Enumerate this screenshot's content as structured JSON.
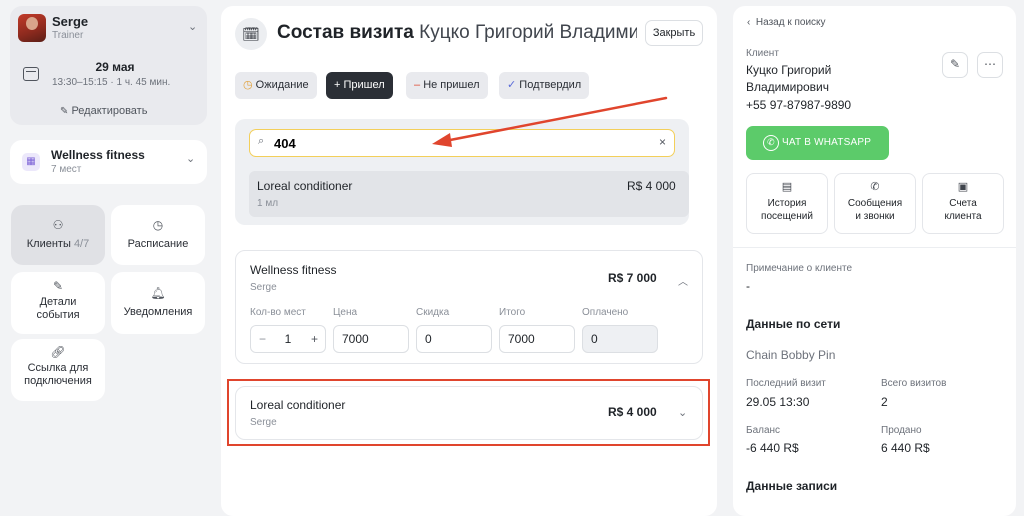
{
  "user": {
    "name": "Serge",
    "role": "Trainer"
  },
  "appointment": {
    "date": "29 мая",
    "time": "13:30–15:15 · 1 ч. 45 мин.",
    "edit_label": "Редактировать"
  },
  "venue": {
    "name": "Wellness fitness",
    "capacity": "7 мест"
  },
  "left_nav": [
    {
      "label": "Клиенты",
      "count": "4/7",
      "icon": "people-icon"
    },
    {
      "label": "Расписание",
      "icon": "clock-icon"
    },
    {
      "label": "Детали события",
      "icon": "edit-doc-icon"
    },
    {
      "label": "Уведомления",
      "icon": "bell-icon"
    },
    {
      "label": "Ссылка для подключения",
      "icon": "link-icon"
    }
  ],
  "header": {
    "title": "Состав визита",
    "client_name": "Куцко Григорий Владими...",
    "close_label": "Закрыть"
  },
  "status_chips": [
    {
      "label": "Ожидание",
      "icon": "clock-icon"
    },
    {
      "label": "Пришел",
      "icon": "plus-icon"
    },
    {
      "label": "Не пришел",
      "icon": "minus-icon"
    },
    {
      "label": "Подтвердил",
      "icon": "check-icon"
    }
  ],
  "search": {
    "value": "404",
    "placeholder": ""
  },
  "search_result": {
    "name": "Loreal conditioner",
    "unit": "1 мл",
    "price": "R$ 4 000"
  },
  "service_item": {
    "name": "Wellness fitness",
    "trainer": "Serge",
    "total": "R$ 7 000",
    "labels": {
      "qty": "Кол-во мест",
      "price": "Цена",
      "discount": "Скидка",
      "total": "Итого",
      "paid": "Оплачено"
    },
    "qty": "1",
    "price": "7000",
    "discount": "0",
    "item_total": "7000",
    "paid": "0"
  },
  "product_item": {
    "name": "Loreal conditioner",
    "trainer": "Serge",
    "price": "R$ 4 000"
  },
  "client": {
    "back_label": "Назад к поиску",
    "section_label": "Клиент",
    "name_line1": "Куцко Григорий",
    "name_line2": "Владимирович",
    "phone": "+55 97-87987-9890",
    "whatsapp_label": "ЧАТ В WHATSAPP",
    "actions": [
      {
        "line1": "История",
        "line2": "посещений",
        "icon": "history-icon"
      },
      {
        "line1": "Сообщения",
        "line2": "и звонки",
        "icon": "phone-icon"
      },
      {
        "line1": "Счета",
        "line2": "клиента",
        "icon": "briefcase-icon"
      }
    ],
    "note_label": "Примечание о клиенте",
    "note_value": "-",
    "network_title": "Данные по сети",
    "network_name": "Chain Bobby Pin",
    "last_visit_label": "Последний визит",
    "last_visit_value": "29.05 13:30",
    "total_visits_label": "Всего визитов",
    "total_visits_value": "2",
    "balance_label": "Баланс",
    "balance_value": "-6 440 R$",
    "sold_label": "Продано",
    "sold_value": "6 440 R$",
    "record_title": "Данные записи"
  },
  "colors": {
    "accent_green": "#5ccb6a",
    "highlight_red": "#e0452d",
    "search_border": "#f3cf5a",
    "dark_chip": "#2b2f36"
  }
}
